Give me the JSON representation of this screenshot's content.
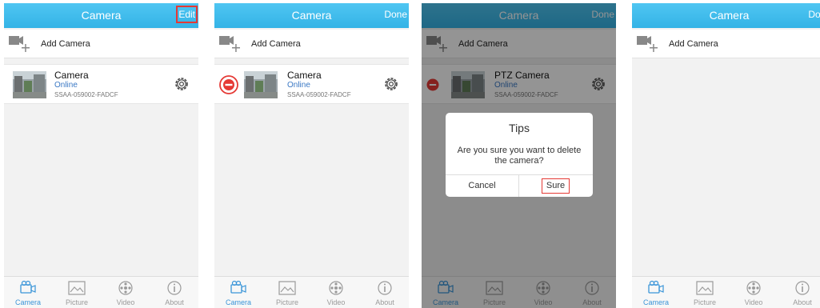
{
  "screens": [
    {
      "title": "Camera",
      "action": "Edit",
      "add_label": "Add Camera",
      "camera": {
        "name": "Camera",
        "status": "Online",
        "id": "SSAA-059002-FADCF"
      }
    },
    {
      "title": "Camera",
      "action": "Done",
      "add_label": "Add Camera",
      "camera": {
        "name": "Camera",
        "status": "Online",
        "id": "SSAA-059002-FADCF"
      }
    },
    {
      "title": "Camera",
      "action": "Done",
      "add_label": "Add Camera",
      "camera": {
        "name": "PTZ Camera",
        "status": "Online",
        "id": "SSAA-059002-FADCF"
      },
      "dialog": {
        "title": "Tips",
        "message": "Are you sure you want to delete the camera?",
        "cancel": "Cancel",
        "sure": "Sure"
      }
    },
    {
      "title": "Camera",
      "action": "Done",
      "add_label": "Add Camera"
    }
  ],
  "tabs": [
    {
      "label": "Camera",
      "icon": "camera-tab-icon"
    },
    {
      "label": "Picture",
      "icon": "picture-icon"
    },
    {
      "label": "Video",
      "icon": "video-reel-icon"
    },
    {
      "label": "About",
      "icon": "info-icon"
    }
  ],
  "colors": {
    "header": "#34b3e6",
    "accent": "#3a95d8",
    "status_online": "#3a78c4",
    "highlight_border": "#e53935",
    "delete_red": "#e53935"
  }
}
